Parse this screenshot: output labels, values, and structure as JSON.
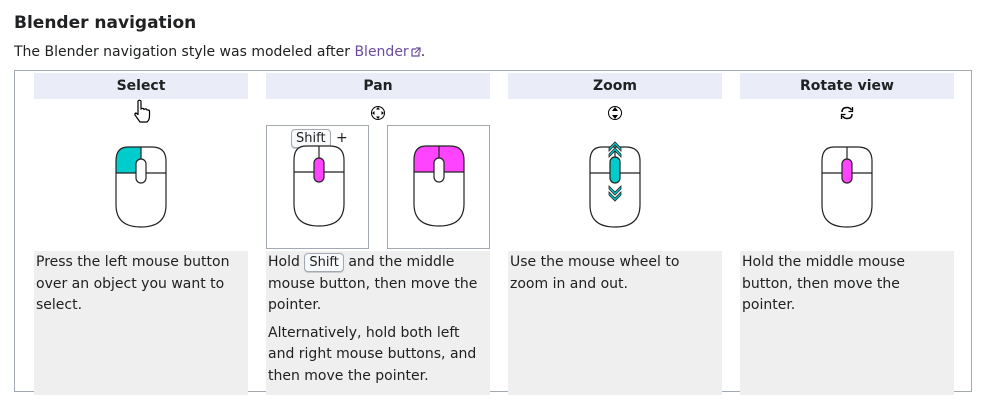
{
  "heading": "Blender navigation",
  "intro": {
    "text": "The Blender navigation style was modeled after ",
    "link": "Blender",
    "suffix": "."
  },
  "colors": {
    "left_button": "#00cccc",
    "middle": "#ff44ff",
    "header_bg": "#eaecf8",
    "desc_bg": "#efefef",
    "link": "#6b4ba1"
  },
  "columns": [
    {
      "header": "Select",
      "cursor_icon": "hand-pointer-icon",
      "desc": "Press the left mouse button over an object you want to select."
    },
    {
      "header": "Pan",
      "cursor_icon": "move-arrows-icon",
      "shift_key": "Shift",
      "plus": "+",
      "desc_prefix": "Hold ",
      "desc_key": "Shift",
      "desc_suffix": " and the middle mouse button, then move the pointer.",
      "desc_alt": "Alternatively, hold both left and right mouse buttons, and then move the pointer."
    },
    {
      "header": "Zoom",
      "cursor_icon": "vertical-resize-icon",
      "desc": "Use the mouse wheel to zoom in and out."
    },
    {
      "header": "Rotate view",
      "cursor_icon": "rotate-icon",
      "desc": "Hold the middle mouse button, then move the pointer."
    }
  ]
}
